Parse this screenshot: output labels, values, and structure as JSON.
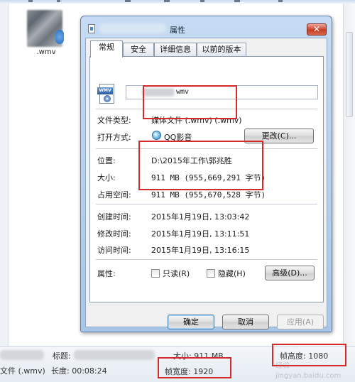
{
  "explorer": {
    "file_label": ".wmv",
    "details": {
      "title_label": "标题:",
      "size_text": "大小: 911 MB",
      "type_text": "文件 (.wmv)",
      "duration_text": "长度: 00:08:24",
      "frame_width_text": "帧宽度: 1920",
      "frame_height_text": "帧高度: 1080"
    },
    "watermark_line1": "经验",
    "watermark_line2": "jingyan.baidu.com"
  },
  "dialog": {
    "title": "属性",
    "close_glyph": "✕",
    "tabs": [
      "常规",
      "安全",
      "详细信息",
      "以前的版本"
    ],
    "general": {
      "file_name_suffix": "wmv",
      "file_type_label": "文件类型:",
      "file_type_value": "媒体文件 (.wmv) (.wmv)",
      "opens_with_label": "打开方式:",
      "opens_with_value": "QQ影音",
      "change_button": "更改(C)...",
      "location_label": "位置:",
      "location_value": "D:\\2015年工作\\郭兆胜",
      "size_label": "大小:",
      "size_value": "911 MB (955,669,291 字节)",
      "size_on_disk_label": "占用空间:",
      "size_on_disk_value": "911 MB (955,670,528 字节)",
      "created_label": "创建时间:",
      "created_value": "2015年1月19日, 13:03:42",
      "modified_label": "修改时间:",
      "modified_value": "2015年1月19日, 13:11:51",
      "accessed_label": "访问时间:",
      "accessed_value": "2015年1月19日, 13:16:15",
      "attributes_label": "属性:",
      "readonly_label": "只读(R)",
      "hidden_label": "隐藏(H)",
      "advanced_button": "高级(D)..."
    },
    "buttons": {
      "ok": "确定",
      "cancel": "取消",
      "apply": "应用(A)"
    }
  }
}
